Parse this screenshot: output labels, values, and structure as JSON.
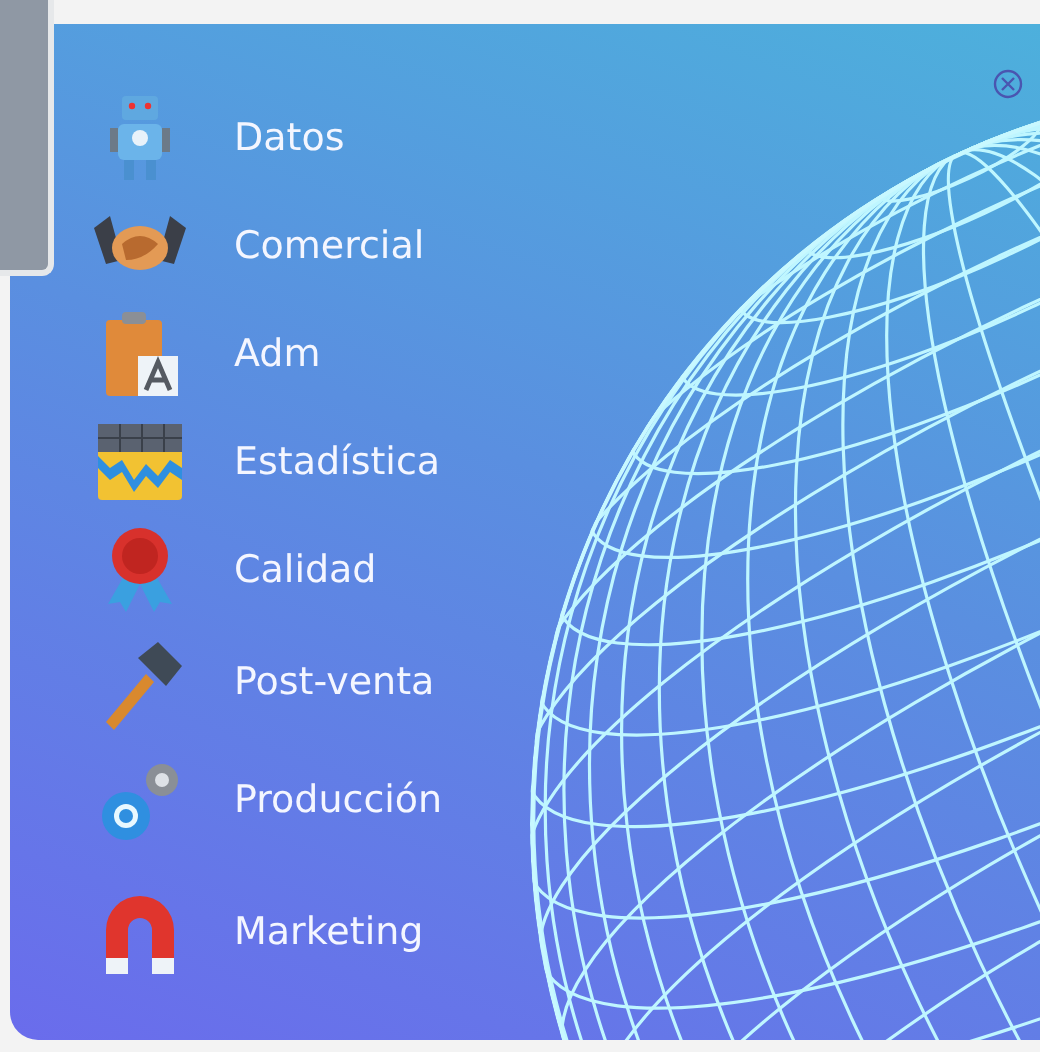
{
  "menu": {
    "items": [
      {
        "label": "Datos"
      },
      {
        "label": "Comercial"
      },
      {
        "label": "Adm"
      },
      {
        "label": "Estadística"
      },
      {
        "label": "Calidad"
      },
      {
        "label": "Post-venta"
      },
      {
        "label": "Producción"
      },
      {
        "label": "Marketing"
      }
    ]
  }
}
